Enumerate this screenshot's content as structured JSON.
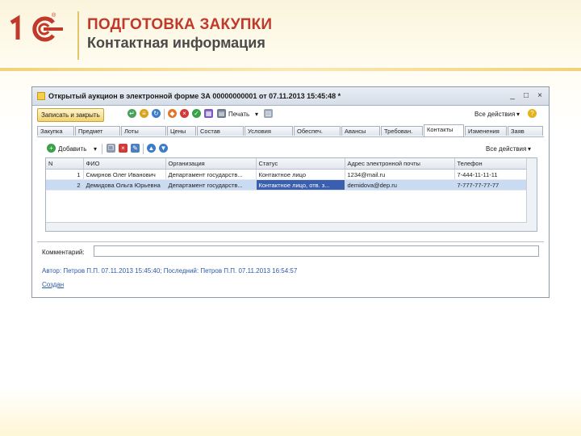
{
  "slide": {
    "title": "ПОДГОТОВКА ЗАКУПКИ",
    "subtitle": "Контактная информация",
    "logo_text": "1С",
    "logo_reg": "®"
  },
  "window": {
    "title": "Открытый аукцион в электронной форме ЗА 00000000001 от 07.11.2013 15:45:48 *",
    "controls": [
      "_",
      "□",
      "×"
    ]
  },
  "toolbar": {
    "save_close": "Записать и закрыть",
    "print": "Печать",
    "all_actions": "Все действия",
    "help": "?"
  },
  "tabs": [
    {
      "label": "Закупка",
      "active": false
    },
    {
      "label": "Предмет",
      "active": false
    },
    {
      "label": "Лоты",
      "active": false
    },
    {
      "label": "Цены",
      "active": false
    },
    {
      "label": "Состав",
      "active": false
    },
    {
      "label": "Условия",
      "active": false
    },
    {
      "label": "Обеспеч.",
      "active": false
    },
    {
      "label": "Авансы",
      "active": false
    },
    {
      "label": "Требован.",
      "active": false
    },
    {
      "label": "Контакты",
      "active": true
    },
    {
      "label": "Изменения",
      "active": false
    },
    {
      "label": "Заяв",
      "active": false
    }
  ],
  "contacts": {
    "add_label": "Добавить",
    "all_actions": "Все действия",
    "columns": [
      "N",
      "ФИО",
      "Организация",
      "Статус",
      "Адрес электронной почты",
      "Телефон"
    ],
    "rows": [
      {
        "n": "1",
        "fio": "Смирнов Олег Иванович",
        "org": "Департамент государств...",
        "status": "Контактное лицо",
        "email": "1234@mail.ru",
        "phone": "7-444-11-11-11"
      },
      {
        "n": "2",
        "fio": "Демидова Ольга Юрьевна",
        "org": "Департамент государств...",
        "status": "Контактное лицо, отв. з...",
        "email": "demidova@dep.ru",
        "phone": "7-777-77-77-77"
      }
    ]
  },
  "comment": {
    "label": "Комментарий:",
    "value": ""
  },
  "footer": {
    "author": "Автор: Петров П.П. 07.11.2013 15:45:40; Последний: Петров П.П. 07.11.2013 16:54:57",
    "created": "Создан"
  },
  "colors": {
    "title_red": "#c0392b",
    "selection_blue": "#3a5eb0",
    "link_blue": "#2b5aa6"
  },
  "icons": [
    "logo-1c-icon",
    "window-icon",
    "post-icon",
    "structure-icon",
    "refresh-icon",
    "stop-icon",
    "ok-icon",
    "goods-icon",
    "print-icon",
    "report-icon",
    "add-icon",
    "copy-icon",
    "delete-icon",
    "edit-icon",
    "move-up-icon",
    "move-down-icon",
    "dropdown-icon",
    "help-icon"
  ]
}
